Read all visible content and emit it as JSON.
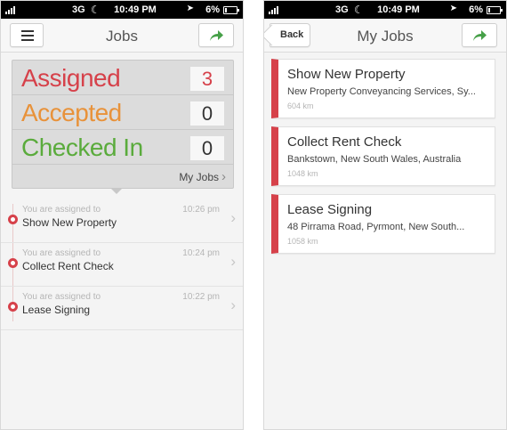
{
  "colors": {
    "assigned": "#d6414a",
    "accepted": "#e8923a",
    "checked_in": "#5aab3c",
    "accent_red": "#d6414a",
    "share_green": "#46a048"
  },
  "status_bar": {
    "carrier": "3G",
    "time": "10:49 PM",
    "battery": "6%"
  },
  "left_screen": {
    "nav": {
      "title": "Jobs",
      "menu_icon": "menu-icon",
      "share_icon": "share-arrow-icon"
    },
    "summary": {
      "rows": [
        {
          "label": "Assigned",
          "count": "3"
        },
        {
          "label": "Accepted",
          "count": "0"
        },
        {
          "label": "Checked In",
          "count": "0"
        }
      ],
      "link_label": "My Jobs"
    },
    "activities": [
      {
        "subtitle": "You are assigned to",
        "title": "Show New Property",
        "time": "10:26 pm"
      },
      {
        "subtitle": "You are assigned to",
        "title": "Collect Rent Check",
        "time": "10:24 pm"
      },
      {
        "subtitle": "You are assigned to",
        "title": "Lease Signing",
        "time": "10:22 pm"
      }
    ]
  },
  "right_screen": {
    "nav": {
      "title": "My Jobs",
      "back_label": "Back",
      "share_icon": "share-arrow-icon"
    },
    "jobs": [
      {
        "title": "Show New Property",
        "address": "New Property Conveyancing Services, Sy...",
        "distance": "604 km"
      },
      {
        "title": "Collect Rent Check",
        "address": "Bankstown, New South Wales, Australia",
        "distance": "1048 km"
      },
      {
        "title": "Lease Signing",
        "address": "48 Pirrama Road, Pyrmont, New South...",
        "distance": "1058 km"
      }
    ]
  }
}
